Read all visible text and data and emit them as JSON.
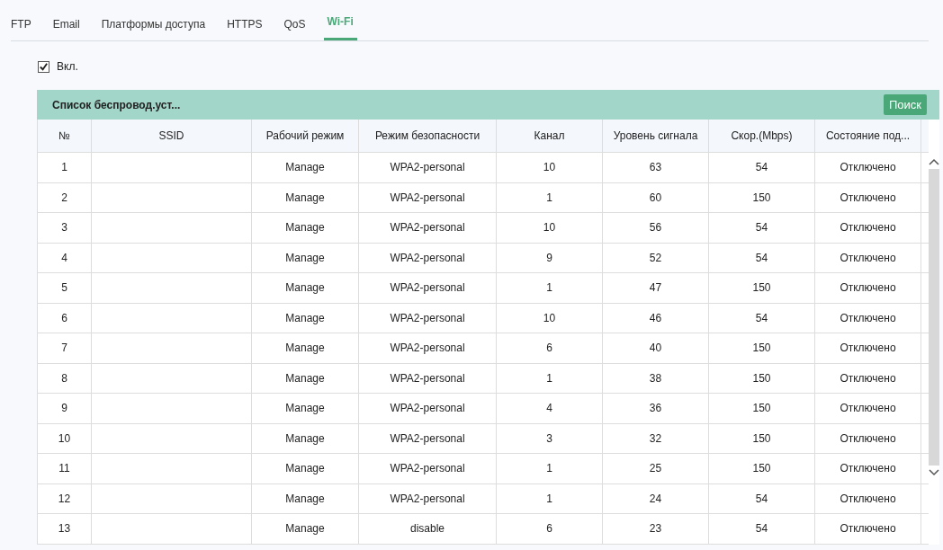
{
  "tabs": [
    {
      "label": "FTP",
      "selected": false
    },
    {
      "label": "Email",
      "selected": false
    },
    {
      "label": "Платформы доступа",
      "selected": false
    },
    {
      "label": "HTTPS",
      "selected": false
    },
    {
      "label": "QoS",
      "selected": false
    },
    {
      "label": "Wi-Fi",
      "selected": true
    }
  ],
  "enable": {
    "label": "Вкл.",
    "checked": true
  },
  "panel": {
    "title": "Список беспровод.уст...",
    "button": "Поиск"
  },
  "table": {
    "columns": [
      "№",
      "SSID",
      "Рабочий режим",
      "Режим безопасности",
      "Канал",
      "Уровень сигнала",
      "Скор.(Mbps)",
      "Состояние под..."
    ],
    "rows": [
      [
        "1",
        "",
        "Manage",
        "WPA2-personal",
        "10",
        "63",
        "54",
        "Отключено"
      ],
      [
        "2",
        "",
        "Manage",
        "WPA2-personal",
        "1",
        "60",
        "150",
        "Отключено"
      ],
      [
        "3",
        "",
        "Manage",
        "WPA2-personal",
        "10",
        "56",
        "54",
        "Отключено"
      ],
      [
        "4",
        "",
        "Manage",
        "WPA2-personal",
        "9",
        "52",
        "54",
        "Отключено"
      ],
      [
        "5",
        "",
        "Manage",
        "WPA2-personal",
        "1",
        "47",
        "150",
        "Отключено"
      ],
      [
        "6",
        "",
        "Manage",
        "WPA2-personal",
        "10",
        "46",
        "54",
        "Отключено"
      ],
      [
        "7",
        "",
        "Manage",
        "WPA2-personal",
        "6",
        "40",
        "150",
        "Отключено"
      ],
      [
        "8",
        "",
        "Manage",
        "WPA2-personal",
        "1",
        "38",
        "150",
        "Отключено"
      ],
      [
        "9",
        "",
        "Manage",
        "WPA2-personal",
        "4",
        "36",
        "150",
        "Отключено"
      ],
      [
        "10",
        "",
        "Manage",
        "WPA2-personal",
        "3",
        "32",
        "150",
        "Отключено"
      ],
      [
        "11",
        "",
        "Manage",
        "WPA2-personal",
        "1",
        "25",
        "150",
        "Отключено"
      ],
      [
        "12",
        "",
        "Manage",
        "WPA2-personal",
        "1",
        "24",
        "54",
        "Отключено"
      ],
      [
        "13",
        "",
        "Manage",
        "disable",
        "6",
        "23",
        "54",
        "Отключено"
      ]
    ]
  }
}
